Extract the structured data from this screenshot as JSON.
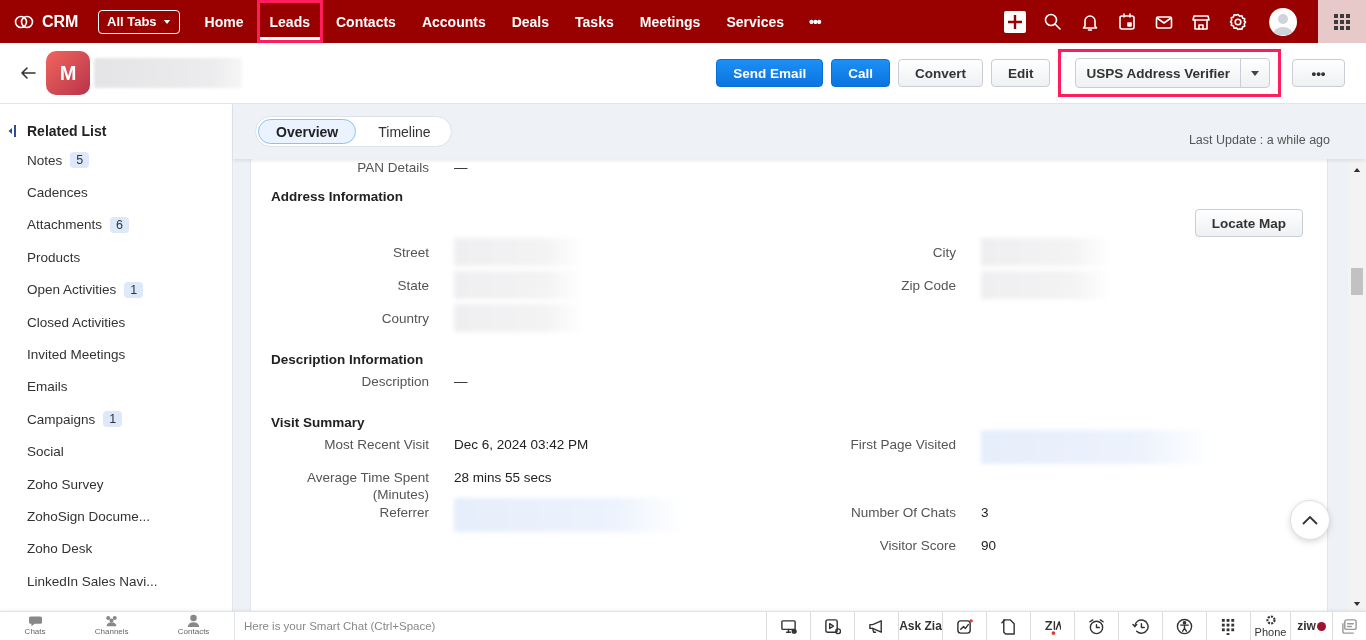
{
  "topbar": {
    "brand": "CRM",
    "all_tabs": "All Tabs",
    "more": "•••",
    "tabs": [
      {
        "label": "Home",
        "selected": false,
        "highlighted": false
      },
      {
        "label": "Leads",
        "selected": true,
        "highlighted": true
      },
      {
        "label": "Contacts",
        "selected": false,
        "highlighted": false
      },
      {
        "label": "Accounts",
        "selected": false,
        "highlighted": false
      },
      {
        "label": "Deals",
        "selected": false,
        "highlighted": false
      },
      {
        "label": "Tasks",
        "selected": false,
        "highlighted": false
      },
      {
        "label": "Meetings",
        "selected": false,
        "highlighted": false
      },
      {
        "label": "Services",
        "selected": false,
        "highlighted": false
      }
    ]
  },
  "record": {
    "avatar_letter": "M",
    "actions": [
      {
        "label": "Send Email",
        "kind": "primary",
        "highlighted": false
      },
      {
        "label": "Call",
        "kind": "primary",
        "highlighted": false
      },
      {
        "label": "Convert",
        "kind": "secondary",
        "highlighted": false
      },
      {
        "label": "Edit",
        "kind": "secondary",
        "highlighted": false
      },
      {
        "label": "USPS Address Verifier",
        "kind": "split",
        "highlighted": true
      },
      {
        "label": "•••",
        "kind": "more",
        "highlighted": false
      }
    ]
  },
  "sidebar": {
    "title": "Related List",
    "items": [
      {
        "label": "Notes",
        "count": "5"
      },
      {
        "label": "Cadences"
      },
      {
        "label": "Attachments",
        "count": "6"
      },
      {
        "label": "Products"
      },
      {
        "label": "Open Activities",
        "count": "1"
      },
      {
        "label": "Closed Activities"
      },
      {
        "label": "Invited Meetings"
      },
      {
        "label": "Emails"
      },
      {
        "label": "Campaigns",
        "count": "1"
      },
      {
        "label": "Social"
      },
      {
        "label": "Zoho Survey"
      },
      {
        "label": "ZohoSign Docume..."
      },
      {
        "label": "Zoho Desk"
      },
      {
        "label": "LinkedIn Sales Navi..."
      }
    ]
  },
  "view_tabs": [
    {
      "label": "Overview",
      "selected": true
    },
    {
      "label": "Timeline",
      "selected": false
    }
  ],
  "last_update": "Last Update : a while ago",
  "partial_field": {
    "label": "PAN Details",
    "value": "—"
  },
  "sections": [
    {
      "title": "Address Information",
      "button": "Locate Map",
      "rows": [
        [
          {
            "label": "Street",
            "redacted": true
          },
          {
            "label": "City",
            "redacted": true
          }
        ],
        [
          {
            "label": "State",
            "redacted": true
          },
          {
            "label": "Zip Code",
            "redacted": true
          }
        ],
        [
          {
            "label": "Country",
            "redacted": true
          },
          null
        ]
      ]
    },
    {
      "title": "Description Information",
      "rows": [
        [
          {
            "label": "Description",
            "value": "—"
          },
          null
        ]
      ]
    },
    {
      "title": "Visit Summary",
      "rows": [
        [
          {
            "label": "Most Recent Visit",
            "value": "Dec 6, 2024 03:42 PM"
          },
          {
            "label": "First Page Visited",
            "redacted": true,
            "link": true
          }
        ],
        [
          {
            "label": "Average Time Spent (Minutes)",
            "value": "28 mins 55 secs"
          },
          null
        ],
        [
          {
            "label": "Referrer",
            "redacted": true,
            "link": true
          },
          {
            "label": "Number Of Chats",
            "value": "3"
          }
        ],
        [
          null,
          {
            "label": "Visitor Score",
            "value": "90"
          }
        ]
      ]
    }
  ],
  "bottom_bar": {
    "apps": [
      {
        "label": "Chats",
        "kind": "chats"
      },
      {
        "label": "Channels",
        "kind": "channels"
      },
      {
        "label": "Contacts",
        "kind": "contacts"
      }
    ],
    "smart_chat_placeholder": "Here is your Smart Chat (Ctrl+Space)",
    "tools": [
      {
        "kind": "screen"
      },
      {
        "kind": "video"
      },
      {
        "kind": "megaphone"
      },
      {
        "kind": "text",
        "label": "Ask Zia"
      },
      {
        "kind": "chart"
      },
      {
        "kind": "note"
      },
      {
        "kind": "zia"
      },
      {
        "kind": "alarm"
      },
      {
        "kind": "history"
      },
      {
        "kind": "accessibility"
      },
      {
        "kind": "dialpad"
      },
      {
        "kind": "phone",
        "label": "Phone"
      },
      {
        "kind": "logo",
        "label": "ziw"
      },
      {
        "kind": "messages"
      }
    ]
  }
}
